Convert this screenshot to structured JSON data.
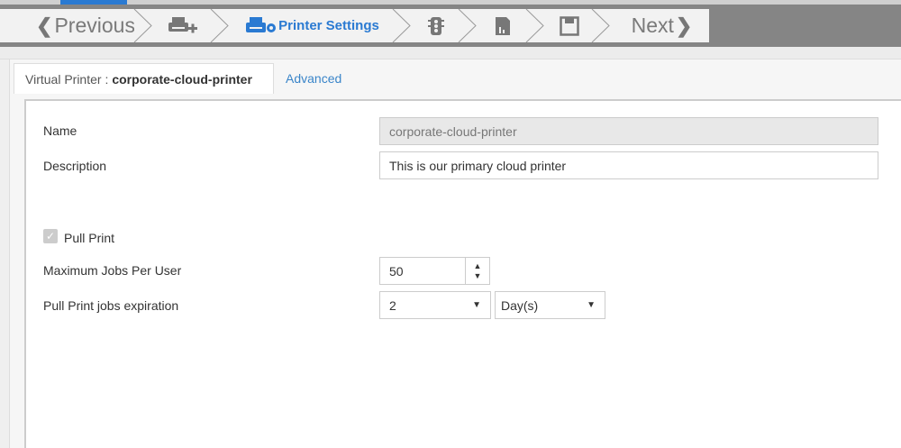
{
  "wizard": {
    "previous": "Previous",
    "active_step": "Printer Settings",
    "next": "Next"
  },
  "tabs": {
    "main_prefix": "Virtual Printer :",
    "main_name": "corporate-cloud-printer",
    "advanced": "Advanced"
  },
  "form": {
    "name_label": "Name",
    "name_value": "corporate-cloud-printer",
    "description_label": "Description",
    "description_value": "This is our primary cloud printer",
    "pull_print_label": "Pull Print",
    "pull_print_checked": true,
    "max_jobs_label": "Maximum Jobs Per User",
    "max_jobs_value": "50",
    "expiration_label": "Pull Print jobs expiration",
    "expiration_value": "2",
    "expiration_unit": "Day(s)"
  },
  "colors": {
    "accent": "#2a7ad2",
    "bar": "#858585"
  }
}
